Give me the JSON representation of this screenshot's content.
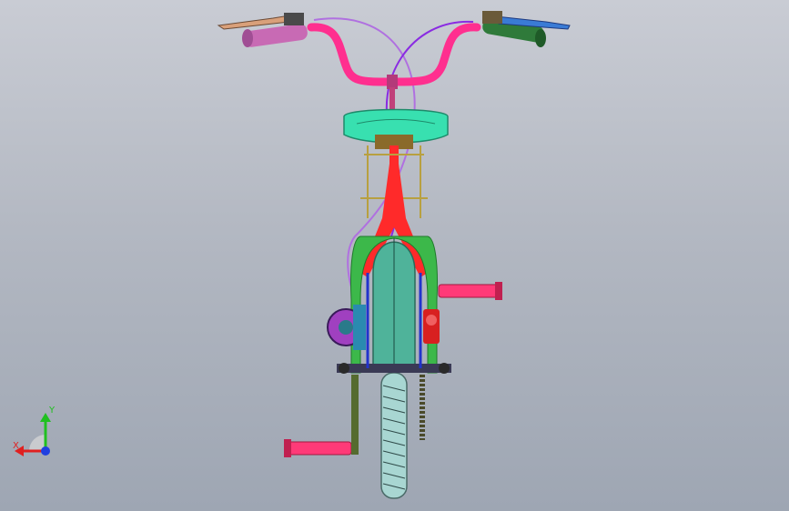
{
  "viewport": {
    "background_top": "#c9ccd4",
    "background_bottom": "#9ea6b3"
  },
  "model": {
    "colors": {
      "handlebar": "#ff2f8f",
      "grip_left": "#c86ab4",
      "grip_right": "#2f7a3a",
      "brake_lever_left": "#d9a07a",
      "brake_lever_right": "#3a7bd5",
      "cable_purple": "#8a2be2",
      "cable_violet": "#b070e0",
      "saddle": "#38e0b0",
      "frame_red": "#ff2a2a",
      "fork_green": "#3cb84a",
      "fender": "#4fb39a",
      "tire": "#a8d6d2",
      "pedal": "#ff3a78",
      "crank_arm": "#556b2f",
      "chain": "#4a4a2a",
      "sprocket": "#a040c0",
      "rack": "#b8a040",
      "hardware_blue": "#2233cc"
    }
  },
  "triad": {
    "icon": "coordinate-triad-icon",
    "x_label": "X",
    "y_label": "Y",
    "x_color": "#e02020",
    "y_color": "#20c020",
    "z_color": "#2040e0"
  }
}
